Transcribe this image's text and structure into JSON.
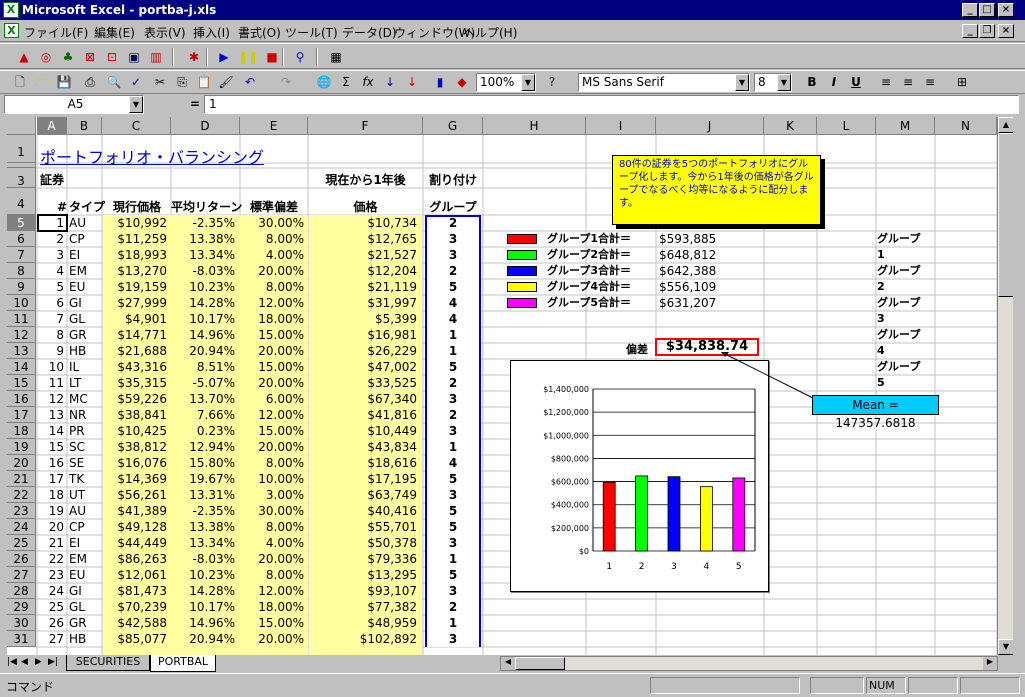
{
  "window": {
    "title": "Microsoft Excel - portba-j.xls",
    "icon": "excel-icon"
  },
  "menu": [
    "ファイル(F)",
    "編集(E)",
    "表示(V)",
    "挿入(I)",
    "書式(O)",
    "ツール(T)",
    "データ(D)",
    "ウィンドウ(W)",
    "ヘルプ(H)"
  ],
  "toolbar": {
    "zoom": "100%",
    "font": "MS Sans Serif",
    "size": "8",
    "bold": "B",
    "italic": "I",
    "underline": "U"
  },
  "formula": {
    "namebox": "A5",
    "eq": "=",
    "value": "1"
  },
  "columns": [
    "A",
    "B",
    "C",
    "D",
    "E",
    "F",
    "G",
    "H",
    "I",
    "J",
    "K",
    "L",
    "M",
    "N"
  ],
  "sheet": {
    "title": "ポートフォリオ・バランシング",
    "label_securities": "証券",
    "label_1year": "現在から1年後",
    "label_assign": "割り付け",
    "headers": {
      "num": "#",
      "type": "タイプ",
      "price": "現行価格",
      "ret": "平均リターン",
      "sd": "標準偏差",
      "future": "価格",
      "group": "グループ"
    },
    "rows": [
      [
        "1",
        "AU",
        "$10,992",
        "-2.35%",
        "30.00%",
        "$10,734",
        "2"
      ],
      [
        "2",
        "CP",
        "$11,259",
        "13.38%",
        "8.00%",
        "$12,765",
        "3"
      ],
      [
        "3",
        "EI",
        "$18,993",
        "13.34%",
        "4.00%",
        "$21,527",
        "3"
      ],
      [
        "4",
        "EM",
        "$13,270",
        "-8.03%",
        "20.00%",
        "$12,204",
        "2"
      ],
      [
        "5",
        "EU",
        "$19,159",
        "10.23%",
        "8.00%",
        "$21,119",
        "5"
      ],
      [
        "6",
        "GI",
        "$27,999",
        "14.28%",
        "12.00%",
        "$31,997",
        "4"
      ],
      [
        "7",
        "GL",
        "$4,901",
        "10.17%",
        "18.00%",
        "$5,399",
        "4"
      ],
      [
        "8",
        "GR",
        "$14,771",
        "14.96%",
        "15.00%",
        "$16,981",
        "1"
      ],
      [
        "9",
        "HB",
        "$21,688",
        "20.94%",
        "20.00%",
        "$26,229",
        "1"
      ],
      [
        "10",
        "IL",
        "$43,316",
        "8.51%",
        "15.00%",
        "$47,002",
        "5"
      ],
      [
        "11",
        "LT",
        "$35,315",
        "-5.07%",
        "20.00%",
        "$33,525",
        "2"
      ],
      [
        "12",
        "MC",
        "$59,226",
        "13.70%",
        "6.00%",
        "$67,340",
        "3"
      ],
      [
        "13",
        "NR",
        "$38,841",
        "7.66%",
        "12.00%",
        "$41,816",
        "2"
      ],
      [
        "14",
        "PR",
        "$10,425",
        "0.23%",
        "15.00%",
        "$10,449",
        "3"
      ],
      [
        "15",
        "SC",
        "$38,812",
        "12.94%",
        "20.00%",
        "$43,834",
        "1"
      ],
      [
        "16",
        "SE",
        "$16,076",
        "15.80%",
        "8.00%",
        "$18,616",
        "4"
      ],
      [
        "17",
        "TK",
        "$14,369",
        "19.67%",
        "10.00%",
        "$17,195",
        "5"
      ],
      [
        "18",
        "UT",
        "$56,261",
        "13.31%",
        "3.00%",
        "$63,749",
        "3"
      ],
      [
        "19",
        "AU",
        "$41,389",
        "-2.35%",
        "30.00%",
        "$40,416",
        "5"
      ],
      [
        "20",
        "CP",
        "$49,128",
        "13.38%",
        "8.00%",
        "$55,701",
        "5"
      ],
      [
        "21",
        "EI",
        "$44,449",
        "13.34%",
        "4.00%",
        "$50,378",
        "3"
      ],
      [
        "22",
        "EM",
        "$86,263",
        "-8.03%",
        "20.00%",
        "$79,336",
        "1"
      ],
      [
        "23",
        "EU",
        "$12,061",
        "10.23%",
        "8.00%",
        "$13,295",
        "5"
      ],
      [
        "24",
        "GI",
        "$81,473",
        "14.28%",
        "12.00%",
        "$93,107",
        "3"
      ],
      [
        "25",
        "GL",
        "$70,239",
        "10.17%",
        "18.00%",
        "$77,382",
        "2"
      ],
      [
        "26",
        "GR",
        "$42,588",
        "14.96%",
        "15.00%",
        "$48,959",
        "1"
      ],
      [
        "27",
        "HB",
        "$85,077",
        "20.94%",
        "20.00%",
        "$102,892",
        "3"
      ]
    ],
    "note": "80件の証券を5つのポートフォリオにグループ化します。今から1年後の価格が各グループでなるべく均等になるように配分します。",
    "groups": [
      {
        "label": "グループ1合計＝",
        "value": "$593,885",
        "color": "#ff0000"
      },
      {
        "label": "グループ2合計＝",
        "value": "$648,812",
        "color": "#00ff00"
      },
      {
        "label": "グループ3合計＝",
        "value": "$642,388",
        "color": "#0000ff"
      },
      {
        "label": "グループ4合計＝",
        "value": "$556,109",
        "color": "#ffff00"
      },
      {
        "label": "グループ5合計＝",
        "value": "$631,207",
        "color": "#ff00ff"
      }
    ],
    "deviation_label": "偏差",
    "deviation_value": "$34,838.74",
    "callout": "Mean = 147357.6818",
    "col_m": [
      "グループ",
      "1",
      "グループ",
      "2",
      "グループ",
      "3",
      "グループ",
      "4",
      "グループ",
      "5"
    ]
  },
  "chart_data": {
    "type": "bar",
    "categories": [
      "1",
      "2",
      "3",
      "4",
      "5"
    ],
    "values": [
      593885,
      648812,
      642388,
      556109,
      631207
    ],
    "colors": [
      "#ff0000",
      "#00ff00",
      "#0000ff",
      "#ffff00",
      "#ff00ff"
    ],
    "ylim": [
      0,
      1400000
    ],
    "yticks": [
      "$0",
      "$200,000",
      "$400,000",
      "$600,000",
      "$800,000",
      "$1,000,000",
      "$1,200,000",
      "$1,400,000"
    ],
    "grid": true
  },
  "tabs": [
    "SECURITIES",
    "PORTBAL"
  ],
  "status": {
    "mode": "コマンド",
    "num": "NUM"
  }
}
